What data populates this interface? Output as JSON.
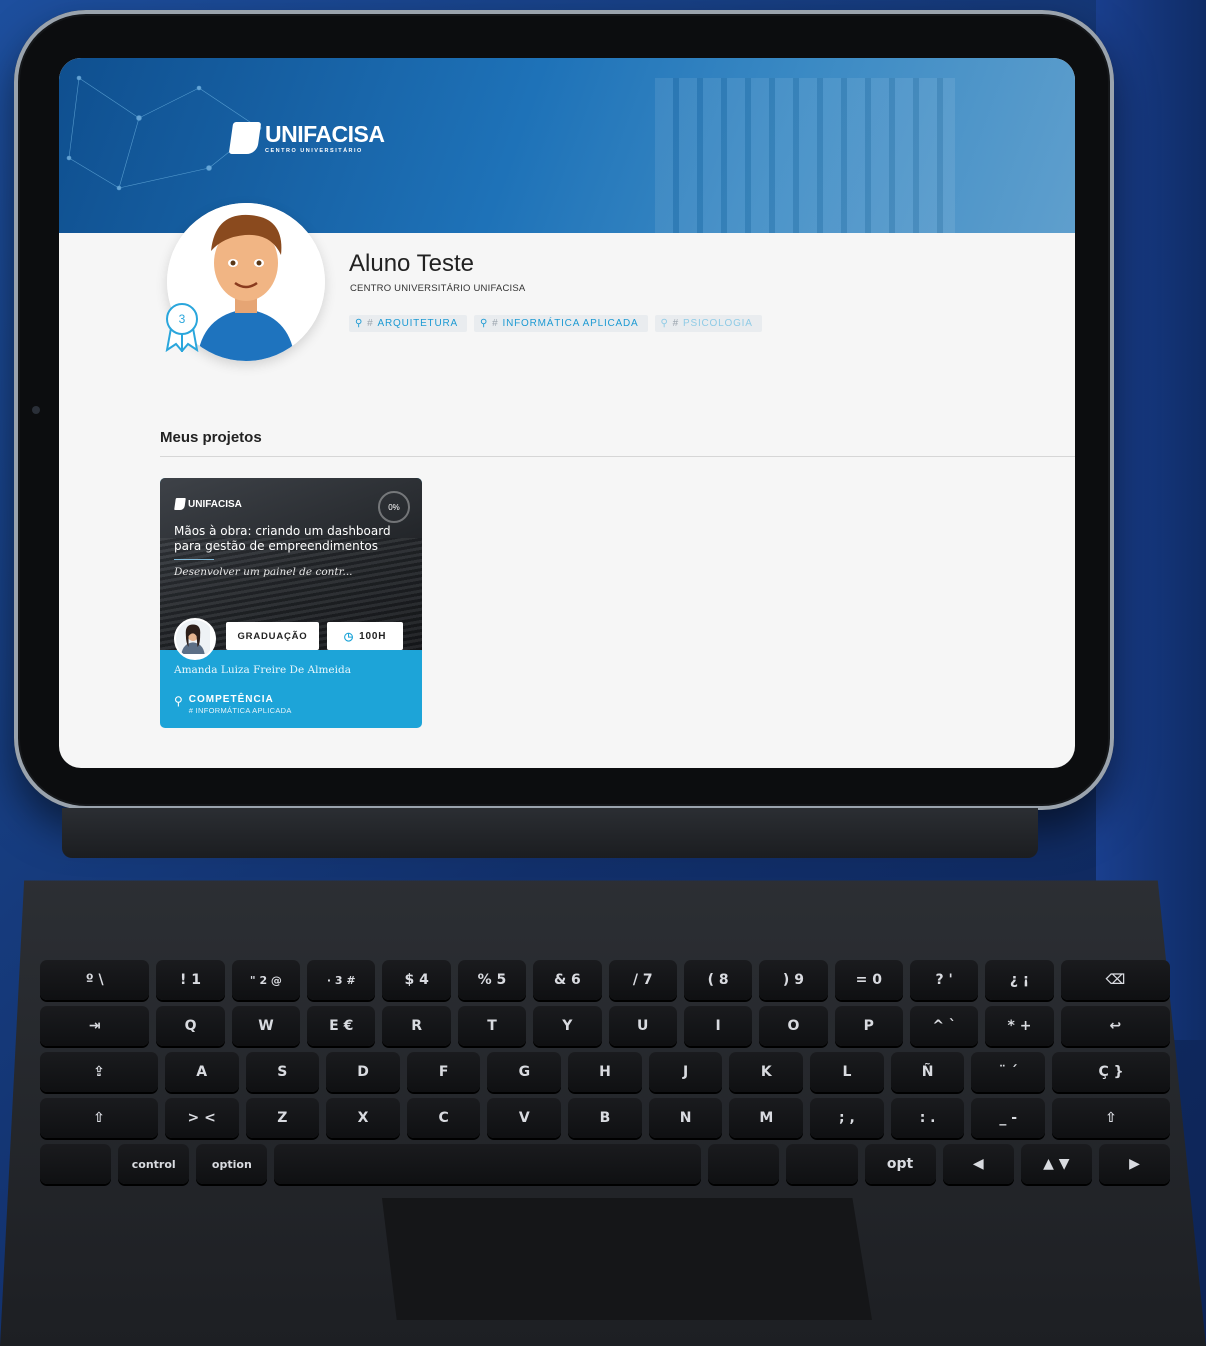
{
  "brand": {
    "logo_text": "UNIFACISA",
    "logo_subtitle": "CENTRO UNIVERSITÁRIO",
    "accent_color": "#1da4d8",
    "banner_color": "#1e72b8"
  },
  "profile": {
    "name": "Aluno Teste",
    "institution": "CENTRO UNIVERSITÁRIO UNIFACISA",
    "badge_count": "3",
    "tags": [
      {
        "hash": "#",
        "label": "ARQUITETURA"
      },
      {
        "hash": "#",
        "label": "INFORMÁTICA APLICADA"
      },
      {
        "hash": "#",
        "label": "PSICOLOGIA"
      }
    ]
  },
  "projects": {
    "section_title": "Meus projetos",
    "items": [
      {
        "logo_text": "UNIFACISA",
        "progress": "0%",
        "title": "Mãos à obra: criando um dashboard para gestão de empreendimentos",
        "description": "Desenvolver um painel de contr...",
        "level": "GRADUAÇÃO",
        "hours": "100H",
        "tutor": "Amanda Luiza Freire De Almeida",
        "competence_label": "COMPETÊNCIA",
        "competence_value": "# INFORMÁTICA APLICADA"
      }
    ]
  },
  "keyboard": {
    "row1": [
      "º \\",
      "! 1",
      "\" 2 @",
      "· 3 #",
      "$ 4",
      "% 5",
      "& 6",
      "/ 7",
      "( 8",
      ") 9",
      "= 0",
      "? '",
      "¿ ¡",
      "⌫"
    ],
    "row2": [
      "⇥",
      "Q",
      "W",
      "E €",
      "R",
      "T",
      "Y",
      "U",
      "I",
      "O",
      "P",
      "^ `",
      "* +",
      "↩"
    ],
    "row3": [
      "⇪",
      "A",
      "S",
      "D",
      "F",
      "G",
      "H",
      "J",
      "K",
      "L",
      "Ñ",
      "¨ ´",
      "Ç }"
    ],
    "row4": [
      "⇧",
      "> <",
      "Z",
      "X",
      "C",
      "V",
      "B",
      "N",
      "M",
      "; ,",
      ": .",
      "_ -",
      "⇧"
    ],
    "row5": [
      "",
      "control",
      "option",
      "",
      "",
      "",
      "opt",
      "◀",
      "▲ ▼",
      "▶"
    ]
  }
}
